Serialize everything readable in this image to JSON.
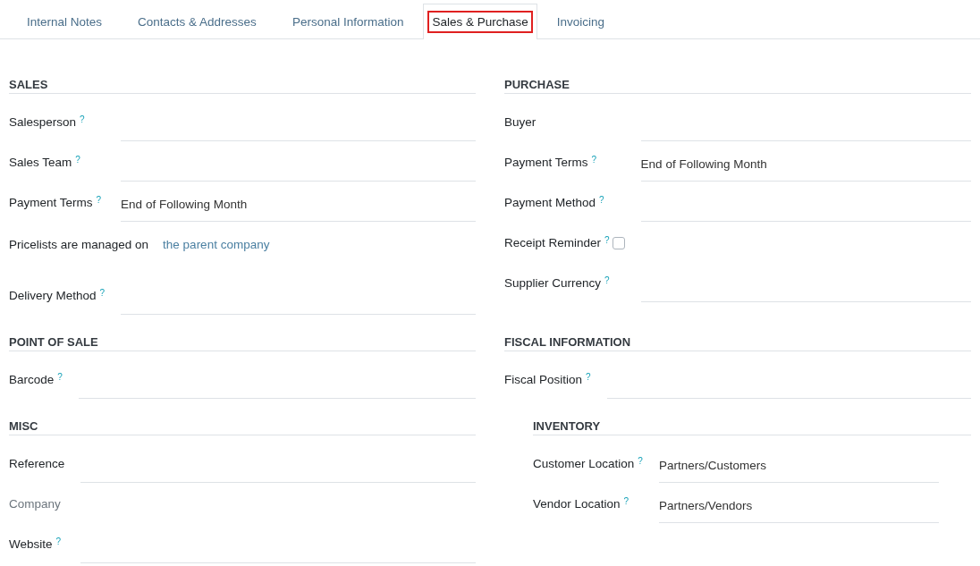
{
  "tabs": [
    {
      "label": "Internal Notes",
      "selected": false
    },
    {
      "label": "Contacts & Addresses",
      "selected": false
    },
    {
      "label": "Personal Information",
      "selected": false
    },
    {
      "label": "Sales & Purchase",
      "selected": true
    },
    {
      "label": "Invoicing",
      "selected": false
    }
  ],
  "section_rows": [
    [
      {
        "title": "SALES",
        "fields": [
          {
            "kind": "field",
            "label": "Salesperson",
            "help": "?"
          },
          {
            "kind": "field",
            "label": "Sales Team",
            "help": "?"
          },
          {
            "kind": "field",
            "label": "Payment Terms",
            "help": "?",
            "value": "End of Following Month"
          },
          {
            "kind": "note",
            "label": "Pricelists are managed on",
            "link": "the parent company"
          },
          {
            "kind": "field",
            "label": "Delivery Method",
            "help": "?"
          }
        ]
      },
      {
        "title": "PURCHASE",
        "fields": [
          {
            "kind": "field",
            "label": "Buyer"
          },
          {
            "kind": "field",
            "label": "Payment Terms",
            "help": "?",
            "value": "End of Following Month"
          },
          {
            "kind": "field",
            "label": "Payment Method",
            "help": "?"
          },
          {
            "kind": "checkbox",
            "label": "Receipt Reminder",
            "help": "?",
            "checked": false
          },
          {
            "kind": "field",
            "label": "Supplier Currency",
            "help": "?"
          }
        ]
      }
    ],
    [
      {
        "title": "POINT OF SALE",
        "fields": [
          {
            "kind": "field",
            "label": "Barcode",
            "help": "?"
          }
        ]
      },
      {
        "title": "FISCAL INFORMATION",
        "fields": [
          {
            "kind": "field",
            "label": "Fiscal Position",
            "help": "?"
          }
        ]
      }
    ],
    [
      {
        "title": "MISC",
        "fields": [
          {
            "kind": "field",
            "label": "Reference"
          },
          {
            "kind": "readonly",
            "label": "Company"
          },
          {
            "kind": "field",
            "label": "Website",
            "help": "?"
          }
        ]
      },
      {
        "title": "INVENTORY",
        "fields": [
          {
            "kind": "field",
            "label": "Customer Location",
            "help": "?",
            "value": "Partners/Customers"
          },
          {
            "kind": "field",
            "label": "Vendor Location",
            "help": "?",
            "value": "Partners/Vendors"
          }
        ]
      }
    ]
  ]
}
